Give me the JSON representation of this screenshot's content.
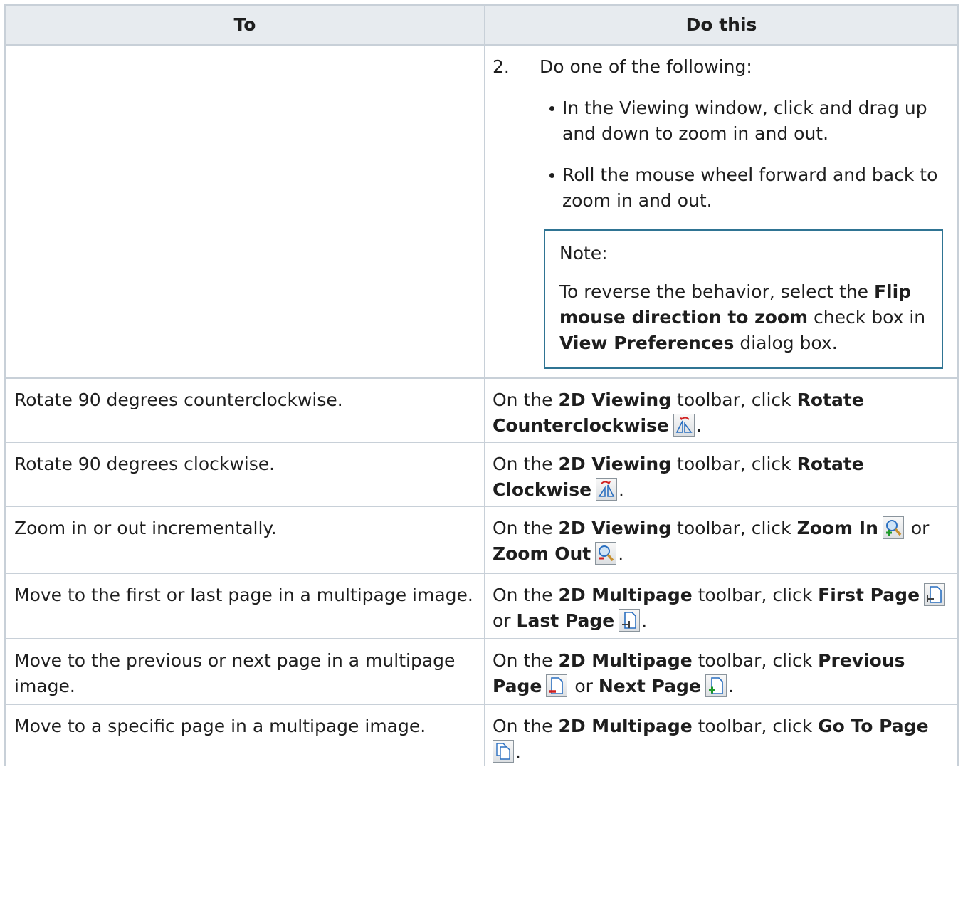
{
  "header": {
    "col1": "To",
    "col2": "Do this"
  },
  "row_zoom_drag": {
    "step_number": "2.",
    "step_text": "Do one of the following:",
    "bullets": [
      "In the Viewing window, click and drag up and down to zoom in and out.",
      "Roll the mouse wheel forward and back to zoom in and out."
    ],
    "note": {
      "title": "Note:",
      "t1": "To reverse the behavior, select the ",
      "b1": "Flip mouse direction to zoom",
      "t2": " check box in ",
      "b2": "View Preferences",
      "t3": " dialog box."
    }
  },
  "rows": [
    {
      "to": "Rotate 90 degrees counterclockwise.",
      "t1": "On the ",
      "b1": "2D Viewing",
      "t2": " toolbar, click ",
      "b2": "Rotate Counterclockwise",
      "t_end": "."
    },
    {
      "to": "Rotate 90 degrees clockwise.",
      "t1": "On the ",
      "b1": "2D Viewing",
      "t2": " toolbar, click ",
      "b2": "Rotate Clockwise",
      "t_end": "."
    },
    {
      "to": "Zoom in or out incrementally.",
      "t1": "On the ",
      "b1": "2D Viewing",
      "t2": " toolbar, click ",
      "b2": "Zoom In",
      "t_or": " or ",
      "b3": "Zoom Out",
      "t_end": "."
    },
    {
      "to": "Move to the first or last page in a multipage image.",
      "t1": "On the ",
      "b1": "2D Multipage",
      "t2": " toolbar, click ",
      "b2": "First Page",
      "t_or": " or ",
      "b3": "Last Page",
      "t_end": "."
    },
    {
      "to": "Move to the previous or next page in a multipage image.",
      "t1": "On the ",
      "b1": "2D Multipage",
      "t2": " toolbar, click ",
      "b2": "Previous Page",
      "t_or": " or ",
      "b3": "Next Page",
      "t_end": "."
    },
    {
      "to": "Move to a specific page in a multipage image.",
      "t1": "On the ",
      "b1": "2D Multipage",
      "t2": " toolbar, click ",
      "b2": "Go To Page",
      "t_end": "."
    }
  ],
  "icons": {
    "rotate_ccw": "rotate-counterclockwise-icon",
    "rotate_cw": "rotate-clockwise-icon",
    "zoom_in": "zoom-in-icon",
    "zoom_out": "zoom-out-icon",
    "first_page": "first-page-icon",
    "last_page": "last-page-icon",
    "previous_page": "previous-page-icon",
    "next_page": "next-page-icon",
    "go_to_page": "go-to-page-icon"
  },
  "colors": {
    "header_bg": "#e7ebef",
    "border": "#c8d0d8",
    "note_border": "#2f7493"
  }
}
